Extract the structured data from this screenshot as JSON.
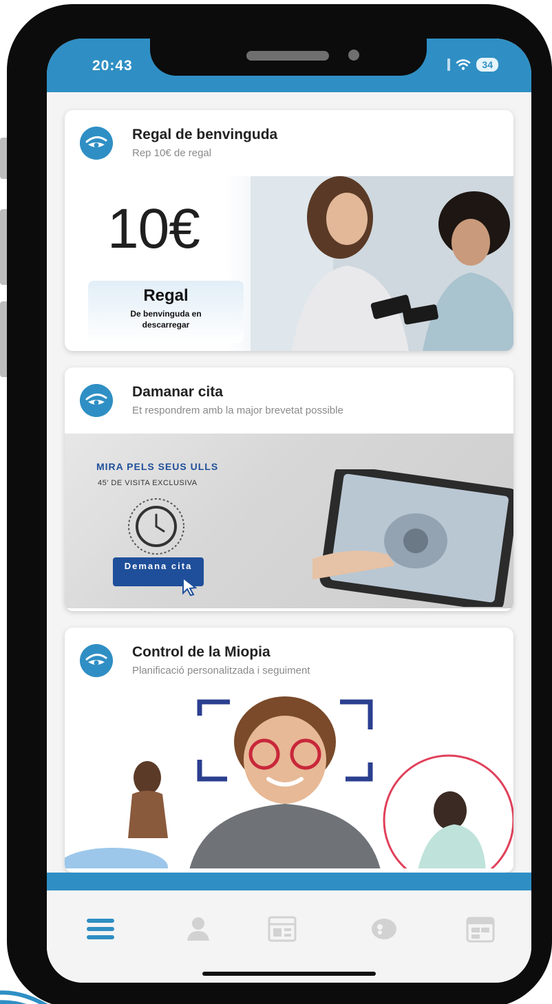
{
  "status_bar": {
    "time": "20:43",
    "battery": "34"
  },
  "cards": [
    {
      "title": "Regal de benvinguda",
      "subtitle": "Rep 10€ de regal",
      "banner": {
        "amount": "10€",
        "badge_title": "Regal",
        "badge_subtitle": "De benvinguda en descarregar"
      }
    },
    {
      "title": "Damanar cita",
      "subtitle": "Et respondrem amb la major brevetat possible",
      "banner": {
        "headline": "MIRA PELS SEUS ULLS",
        "subheadline": "45' DE VISITA EXCLUSIVA",
        "cta_label": "Demana cita"
      }
    },
    {
      "title": "Control de la Miopia",
      "subtitle": "Planificació personalitzada i seguiment"
    }
  ],
  "tab_bar": {
    "tabs": [
      {
        "icon": "menu-icon",
        "active": true
      },
      {
        "icon": "user-icon",
        "active": false
      },
      {
        "icon": "catalog-icon",
        "active": false
      },
      {
        "icon": "contact-lens-icon",
        "active": false
      },
      {
        "icon": "calendar-icon",
        "active": false
      }
    ]
  },
  "colors": {
    "brand": "#2f8fc4",
    "promo_blue": "#1f4f9a",
    "accent_ring": "#e0405a",
    "inactive_icon": "#d2d2d2"
  }
}
